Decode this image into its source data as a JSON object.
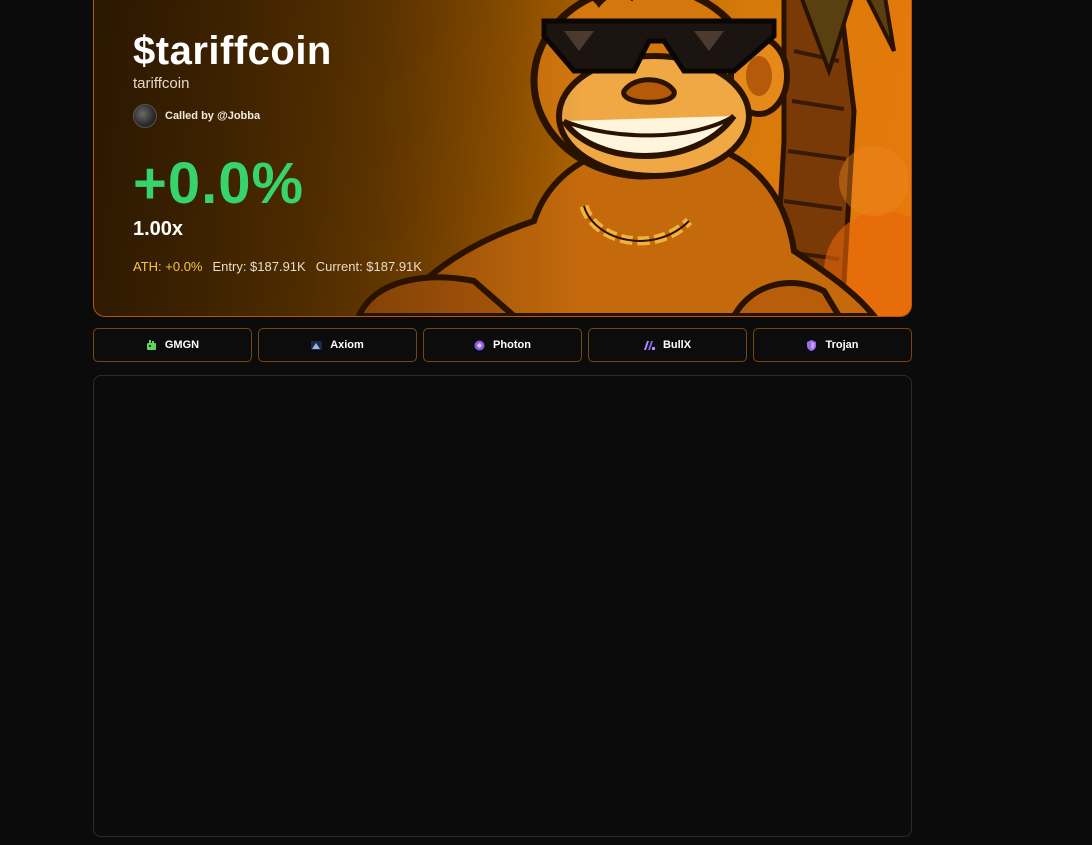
{
  "token": {
    "ticker": "$tariffcoin",
    "name": "tariffcoin",
    "called_by_prefix": "Called by ",
    "caller": "@Jobba",
    "change_pct": "+0.0%",
    "multiplier": "1.00x",
    "ath": "ATH: +0.0%",
    "entry": "Entry: $187.91K",
    "current": "Current: $187.91K"
  },
  "colors": {
    "accent_border": "#b8560f",
    "gain_green": "#37d46b",
    "ath_yellow": "#f5c542",
    "background": "#0b0b0b"
  },
  "trade_buttons": [
    {
      "label": "GMGN",
      "icon": "gmgn-icon"
    },
    {
      "label": "Axiom",
      "icon": "axiom-icon"
    },
    {
      "label": "Photon",
      "icon": "photon-icon"
    },
    {
      "label": "BullX",
      "icon": "bullx-icon"
    },
    {
      "label": "Trojan",
      "icon": "trojan-icon"
    }
  ]
}
